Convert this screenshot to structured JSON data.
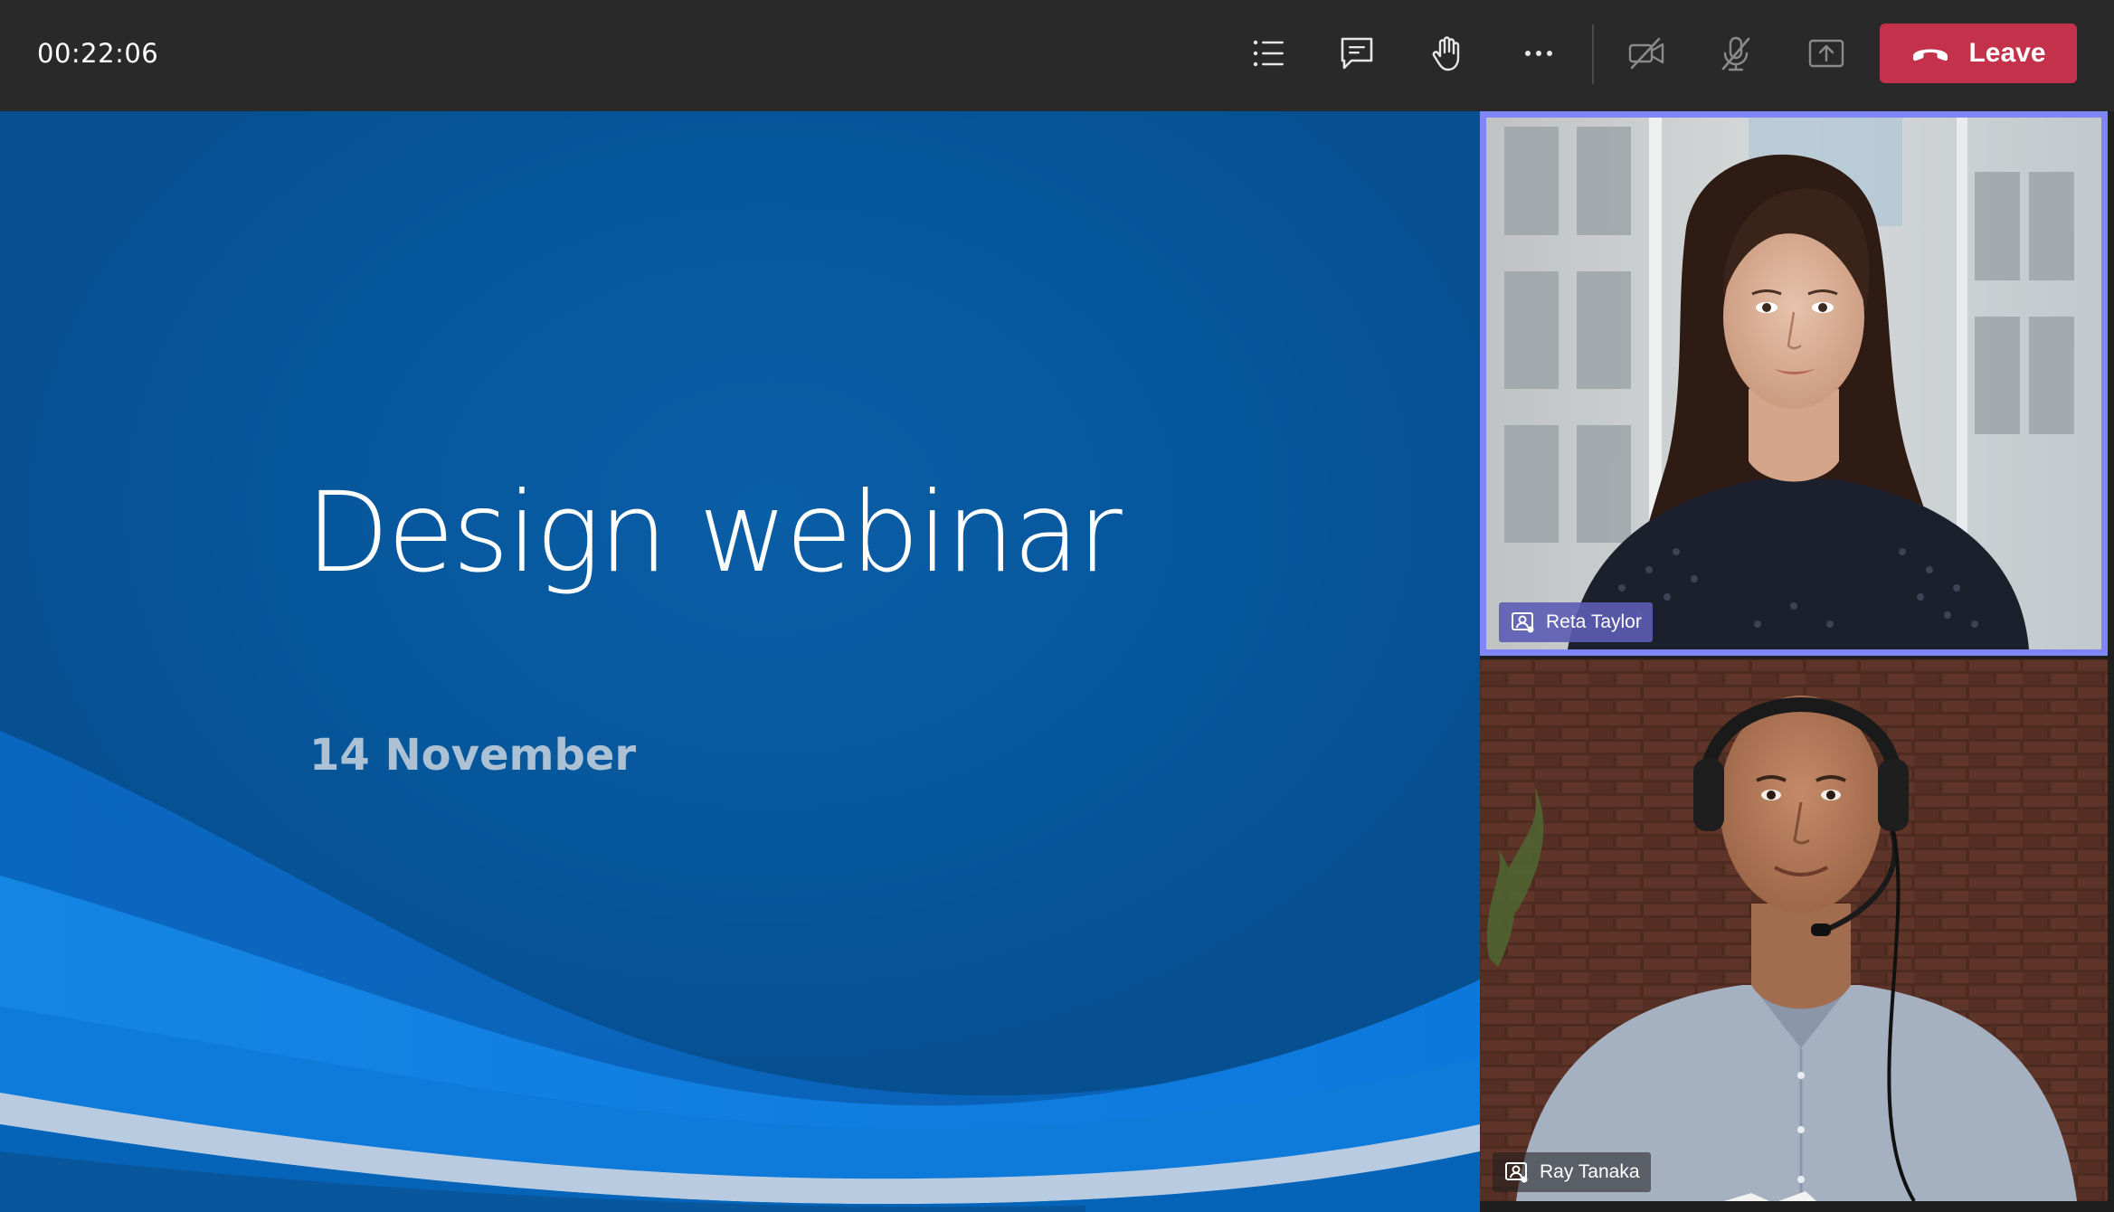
{
  "meeting": {
    "elapsed_time": "00:22:06"
  },
  "toolbar": {
    "buttons": [
      {
        "icon": "participants-list-icon"
      },
      {
        "icon": "chat-icon"
      },
      {
        "icon": "raise-hand-icon"
      },
      {
        "icon": "more-options-icon"
      },
      {
        "icon": "camera-off-icon"
      },
      {
        "icon": "mic-off-icon"
      },
      {
        "icon": "share-screen-icon"
      }
    ],
    "leave_label": "Leave",
    "leave_color": "#c4314b",
    "leave_icon": "hang-up-phone-icon"
  },
  "slide": {
    "title": "Design webinar",
    "subtitle": "14 November",
    "background_color": "#07569a"
  },
  "participants": [
    {
      "name": "Reta Taylor",
      "active_speaker": true,
      "highlight_color": "#7f85f5",
      "icon": "presenter-icon"
    },
    {
      "name": "Ray Tanaka",
      "active_speaker": false,
      "icon": "presenter-icon"
    }
  ]
}
